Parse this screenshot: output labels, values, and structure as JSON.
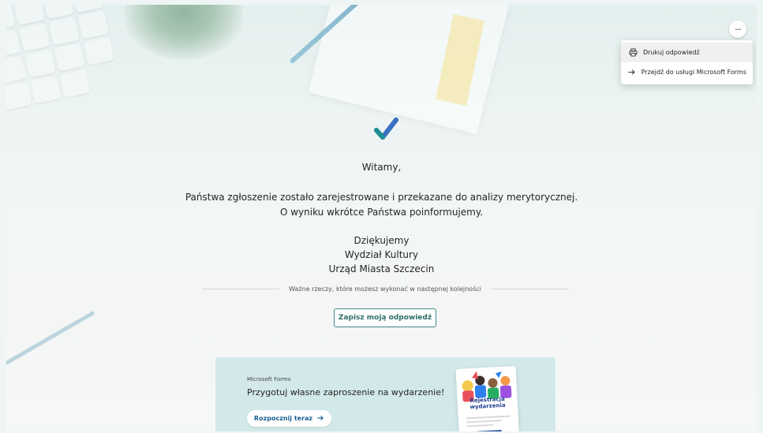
{
  "menu": {
    "more_label": "···",
    "items": [
      {
        "label": "Drukuj odpowiedź",
        "icon": "printer-icon"
      },
      {
        "label": "Przejdź do usługi Microsoft Forms",
        "icon": "arrow-right-icon"
      }
    ]
  },
  "message": {
    "greeting": "Witamy,",
    "line1": "Państwa zgłoszenie zostało zarejestrowane i przekazane do analizy merytorycznej.",
    "line2": "O wyniku wkrótce Państwa poinformujemy.",
    "thanks": "Dziękujemy",
    "department": "Wydział Kultury",
    "office": "Urząd Miasta Szczecin"
  },
  "next_steps": {
    "label": "Ważne rzeczy, które możesz wykonać w następnej kolejności",
    "save_button": "Zapisz moją odpowiedź"
  },
  "promo": {
    "brand": "Microsoft Forms",
    "title": "Przygotuj własne zaproszenie na wydarzenie!",
    "cta": "Rozpocznij teraz",
    "cta_icon": "arrow-right-icon",
    "poster_title": "Rejestracja wydarzenia"
  },
  "colors": {
    "accent": "#3f8a86",
    "cta_text": "#1a5e92",
    "promo_bg": "#d3e9e9"
  }
}
